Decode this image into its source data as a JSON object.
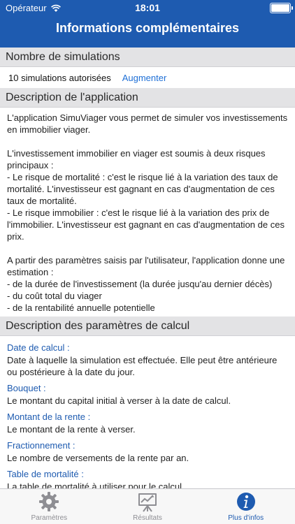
{
  "status": {
    "carrier": "Opérateur",
    "time": "18:01"
  },
  "nav": {
    "title": "Informations complémentaires"
  },
  "simulations": {
    "header": "Nombre de simulations",
    "count_label": "10 simulations autorisées",
    "increase_label": "Augmenter"
  },
  "description": {
    "header": "Description de l'application",
    "p1": "L'application SimuViager vous permet de simuler vos investissements en immobilier viager.",
    "p2": "L'investissement immobilier en viager est soumis à deux risques principaux :\n- Le risque de mortalité : c'est le risque lié à la variation des taux de mortalité. L'investisseur est gagnant en cas d'augmentation de ces taux de mortalité.\n- Le risque immobilier : c'est le risque lié à la variation des prix de l'immobilier. L'investisseur est gagnant en cas d'augmentation de ces prix.",
    "p3": "A partir des paramètres saisis par l'utilisateur, l'application donne une estimation :\n- de la durée de l'investissement (la durée jusqu'au dernier décès)\n- du coût total du viager\n- de la rentabilité annuelle potentielle"
  },
  "params": {
    "header": "Description des paramètres de calcul",
    "items": [
      {
        "name": "Date de calcul :",
        "text": "Date à laquelle la simulation est effectuée. Elle peut être antérieure ou postérieure à la date du jour."
      },
      {
        "name": "Bouquet :",
        "text": "Le montant du capital initial à verser à la date de calcul."
      },
      {
        "name": "Montant de la rente :",
        "text": "Le montant de la rente à verser."
      },
      {
        "name": "Fractionnement :",
        "text": "Le nombre de versements de la rente par an."
      },
      {
        "name": "Table de mortalité :",
        "text": "La table de mortalité à utiliser pour le calcul."
      }
    ]
  },
  "tabs": [
    {
      "label": "Paramètres",
      "icon": "gear-icon"
    },
    {
      "label": "Résultats",
      "icon": "chart-board-icon"
    },
    {
      "label": "Plus d'infos",
      "icon": "info-icon"
    }
  ],
  "colors": {
    "accent": "#1e5bb0",
    "link": "#1e6fd6",
    "section_bg": "#e3e3e5",
    "tab_inactive": "#8e8e93"
  }
}
